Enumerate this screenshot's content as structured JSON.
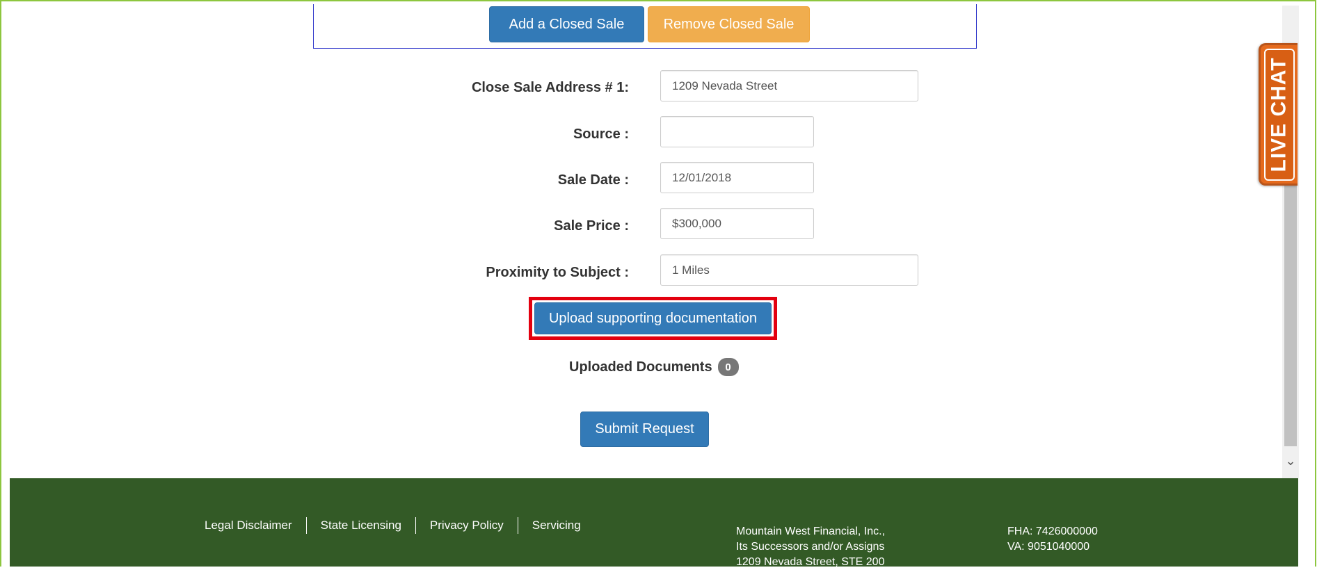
{
  "top_buttons": {
    "add": "Add a Closed Sale",
    "remove": "Remove Closed Sale"
  },
  "form": {
    "address": {
      "label": "Close Sale Address # 1:",
      "value": "1209 Nevada Street"
    },
    "source": {
      "label": "Source :",
      "value": ""
    },
    "sale_date": {
      "label": "Sale Date :",
      "value": "12/01/2018"
    },
    "sale_price": {
      "label": "Sale Price :",
      "value": "$300,000"
    },
    "proximity": {
      "label": "Proximity to Subject :",
      "value": "1 Miles"
    }
  },
  "upload_button": "Upload supporting documentation",
  "uploaded_documents": {
    "label": "Uploaded Documents",
    "count": "0"
  },
  "submit_button": "Submit Request",
  "live_chat": "LIVE CHAT",
  "footer": {
    "links": [
      "Legal Disclaimer",
      "State Licensing",
      "Privacy Policy",
      "Servicing"
    ],
    "company_lines": [
      "Mountain West Financial, Inc.,",
      "Its Successors and/or Assigns",
      "1209 Nevada Street, STE 200"
    ],
    "ids": [
      "FHA: 7426000000",
      "VA: 9051040000"
    ]
  },
  "colors": {
    "primary": "#337ab7",
    "warning": "#f0ad4e",
    "footer": "#335a26",
    "live_chat": "#e56a1d",
    "highlight": "#e3000f"
  }
}
